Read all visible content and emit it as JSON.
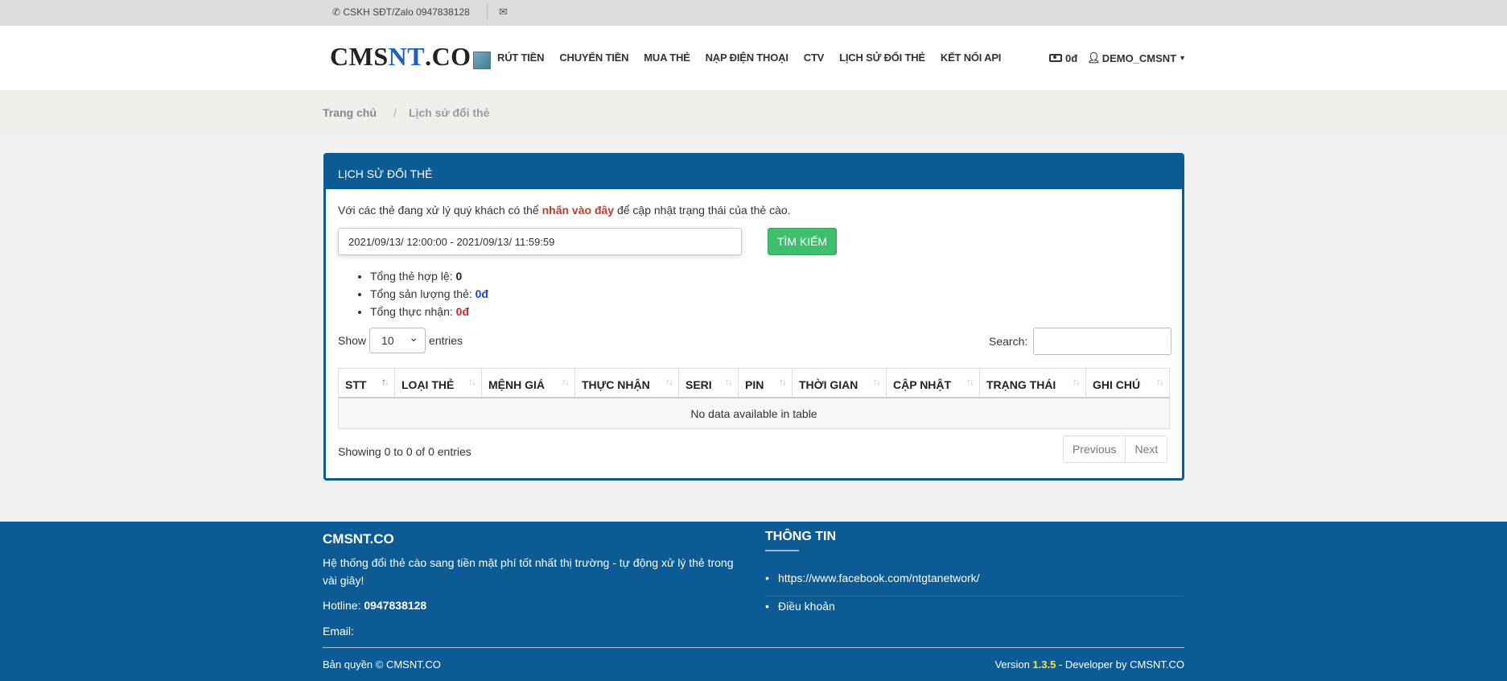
{
  "topbar": {
    "phone_icon": "phone-icon",
    "phone_text": "CSKH SĐT/Zalo 0947838128",
    "mail_icon": "envelope-icon"
  },
  "navbar": {
    "logo": {
      "part1": "CMS",
      "part2": "NT",
      "part3": ".CO"
    },
    "links": [
      "RÚT TIỀN",
      "CHUYỂN TIỀN",
      "MUA THẺ",
      "NẠP ĐIỆN THOẠI",
      "CTV",
      "LỊCH SỬ ĐỔI THẺ",
      "KẾT NỐI API"
    ],
    "balance": "0đ",
    "user": "DEMO_CMSNT"
  },
  "breadcrumb": {
    "home": "Trang chủ",
    "separator": "/",
    "current": "Lịch sử đổi thẻ"
  },
  "card": {
    "title": "LỊCH SỬ ĐỔI THẺ",
    "notice_before": "Với các thẻ đang xử lý quý khách có thể ",
    "notice_link": "nhấn vào đây",
    "notice_after": " để cập nhật trạng thái của thẻ cào.",
    "date_range": "2021/09/13/ 12:00:00 - 2021/09/13/ 11:59:59",
    "search_button": "TÌM KIẾM",
    "stats": [
      {
        "label": "Tổng thẻ hợp lệ: ",
        "value": "0"
      },
      {
        "label": "Tổng sản lượng thẻ: ",
        "value": "0đ"
      },
      {
        "label": "Tổng thực nhận: ",
        "value": "0đ"
      }
    ],
    "show_label": "Show",
    "show_value": "10",
    "entries_label": "entries",
    "search_label": "Search:",
    "columns": [
      "STT",
      "LOẠI THẺ",
      "MỆNH GIÁ",
      "THỰC NHẬN",
      "SERI",
      "PIN",
      "THỜI GIAN",
      "CẬP NHẬT",
      "TRẠNG THÁI",
      "GHI CHÚ"
    ],
    "empty_text": "No data available in table",
    "info_text": "Showing 0 to 0 of 0 entries",
    "prev_label": "Previous",
    "next_label": "Next"
  },
  "footer": {
    "brand": "CMSNT.CO",
    "description": "Hệ thống đổi thẻ cào sang tiền mặt phí tốt nhất thị trường - tự động xử lý thẻ trong vài giây!",
    "hotline_label": "Hotline: ",
    "hotline": "0947838128",
    "email_label": "Email:",
    "info_title": "THÔNG TIN",
    "links": [
      "https://www.facebook.com/ntgtanetwork/",
      "Điều khoản"
    ],
    "copyright": "Bản quyền © CMSNT.CO",
    "version_label": "Version ",
    "version": "1.3.5",
    "developer": " - Developer by CMSNT.CO"
  },
  "colors": {
    "primary": "#0d5b94",
    "success": "#3ebf6d",
    "link_red": "#c0392b"
  }
}
